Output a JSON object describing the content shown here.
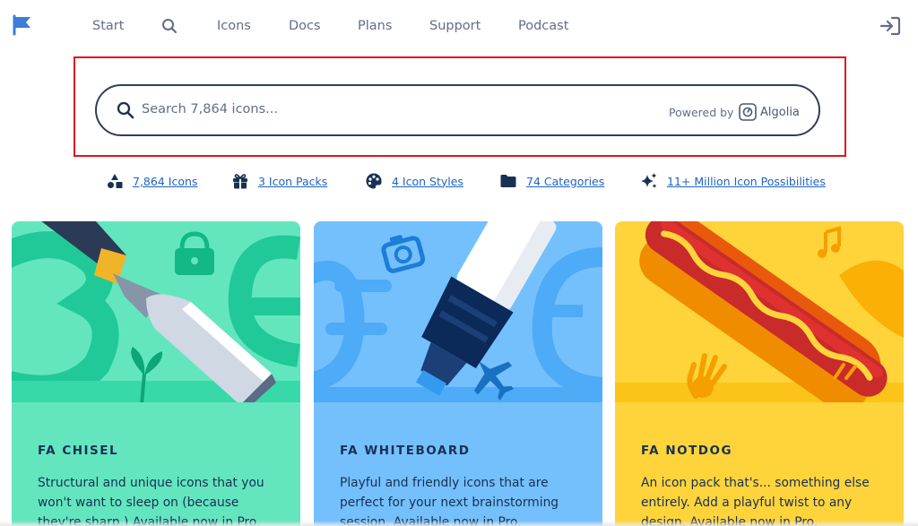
{
  "nav": {
    "items": [
      {
        "label": "Start"
      },
      {
        "label": "Icons"
      },
      {
        "label": "Docs"
      },
      {
        "label": "Plans"
      },
      {
        "label": "Support"
      },
      {
        "label": "Podcast"
      }
    ],
    "icons": {
      "logo": "flag-icon",
      "search": "search-icon",
      "signin": "sign-in-icon"
    }
  },
  "search": {
    "placeholder": "Search 7,864 icons...",
    "powered_by": "Powered by",
    "provider": "Algolia"
  },
  "stats": [
    {
      "label": "7,864 Icons",
      "icon": "shapes-icon"
    },
    {
      "label": "3 Icon Packs",
      "icon": "gift-icon"
    },
    {
      "label": "4 Icon Styles",
      "icon": "palette-icon"
    },
    {
      "label": "74 Categories",
      "icon": "folder-icon"
    },
    {
      "label": "11+ Million Icon Possibilities",
      "icon": "sparkles-icon"
    }
  ],
  "cards": [
    {
      "title": "FA CHISEL",
      "description": "Structural and unique icons that you won't want to sleep on (because they're sharp.) Available now in Pro.",
      "color": "#63e6be"
    },
    {
      "title": "FA WHITEBOARD",
      "description": "Playful and friendly icons that are perfect for your next brainstorming session. Available now in Pro.",
      "color": "#74c0fc"
    },
    {
      "title": "FA NOTDOG",
      "description": "An icon pack that's... something else entirely. Add a playful twist to any design. Available now in Pro.",
      "color": "#ffd43b"
    }
  ],
  "colors": {
    "accent": "#1e63c4",
    "highlight": "#e0141b",
    "text": "#183153"
  }
}
